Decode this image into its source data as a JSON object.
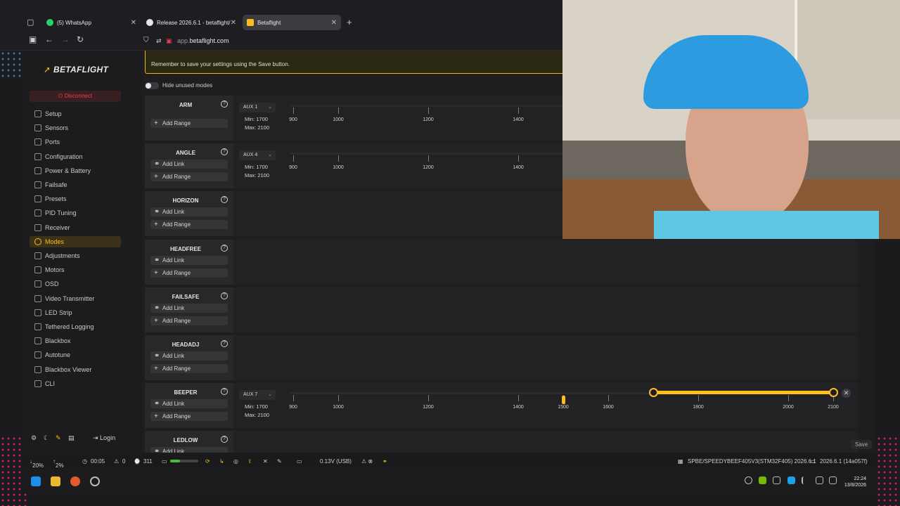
{
  "browser": {
    "tabs": [
      {
        "label": "(5) WhatsApp",
        "active": false
      },
      {
        "label": "Release 2026.6.1 - betaflight/be",
        "active": false
      },
      {
        "label": "Betaflight",
        "active": true
      }
    ],
    "url_prefix": "app.",
    "url_domain": "betaflight.com"
  },
  "app": {
    "logo_text": "BETAFLIGHT",
    "disconnect_label": "Disconnect",
    "nav": [
      {
        "label": "Setup",
        "icon": "setup-icon"
      },
      {
        "label": "Sensors",
        "icon": "sensors-icon"
      },
      {
        "label": "Ports",
        "icon": "ports-icon"
      },
      {
        "label": "Configuration",
        "icon": "configuration-icon"
      },
      {
        "label": "Power & Battery",
        "icon": "power-icon"
      },
      {
        "label": "Failsafe",
        "icon": "failsafe-icon"
      },
      {
        "label": "Presets",
        "icon": "presets-icon"
      },
      {
        "label": "PID Tuning",
        "icon": "pid-icon"
      },
      {
        "label": "Receiver",
        "icon": "receiver-icon"
      },
      {
        "label": "Modes",
        "icon": "modes-icon",
        "active": true
      },
      {
        "label": "Adjustments",
        "icon": "adjustments-icon"
      },
      {
        "label": "Motors",
        "icon": "motors-icon"
      },
      {
        "label": "OSD",
        "icon": "osd-icon"
      },
      {
        "label": "Video Transmitter",
        "icon": "vtx-icon"
      },
      {
        "label": "LED Strip",
        "icon": "led-icon"
      },
      {
        "label": "Tethered Logging",
        "icon": "tethered-icon"
      },
      {
        "label": "Blackbox",
        "icon": "blackbox-icon"
      },
      {
        "label": "Autotune",
        "icon": "autotune-icon"
      },
      {
        "label": "Blackbox Viewer",
        "icon": "blackbox-viewer-icon"
      },
      {
        "label": "CLI",
        "icon": "cli-icon"
      }
    ],
    "login_label": "Login",
    "banner_text": "Remember to save your settings using the Save button.",
    "hide_unused_label": "Hide unused modes",
    "add_link_label": "Add Link",
    "add_range_label": "Add Range",
    "min_label": "Min: 1700",
    "max_label": "Max: 2100",
    "save_label": "Save",
    "modes": [
      {
        "name": "ARM",
        "aux": "AUX 1",
        "has_link": false,
        "slider": true
      },
      {
        "name": "ANGLE",
        "aux": "AUX 4",
        "has_link": true,
        "slider": true
      },
      {
        "name": "HORIZON",
        "has_link": true,
        "slider": false
      },
      {
        "name": "HEADFREE",
        "has_link": true,
        "slider": false
      },
      {
        "name": "FAILSAFE",
        "has_link": true,
        "slider": false
      },
      {
        "name": "HEADADJ",
        "has_link": true,
        "slider": false
      },
      {
        "name": "BEEPER",
        "aux": "AUX 7",
        "has_link": true,
        "slider": true,
        "range": [
          1700,
          2100
        ],
        "value": 1500
      },
      {
        "name": "LEDLOW",
        "has_link": true,
        "slider": false
      }
    ],
    "scale_ticks": [
      "900",
      "1000",
      "1200",
      "1400",
      "1500",
      "1600",
      "1800",
      "2000",
      "2100"
    ],
    "accent_color": "#ffbe1a"
  },
  "status": {
    "cpu": "20%",
    "up": "2%",
    "time": "00:05",
    "warn_count": "0",
    "cycles": "311",
    "voltage": "0.13V (USB)",
    "board": "SPBE/SPEEDYBEEF405V3(STM32F405) 2026.6.1",
    "version": "2026.6.1 (14a057f)"
  },
  "taskbar": {
    "time": "22:24",
    "date": "13/8/2026"
  }
}
